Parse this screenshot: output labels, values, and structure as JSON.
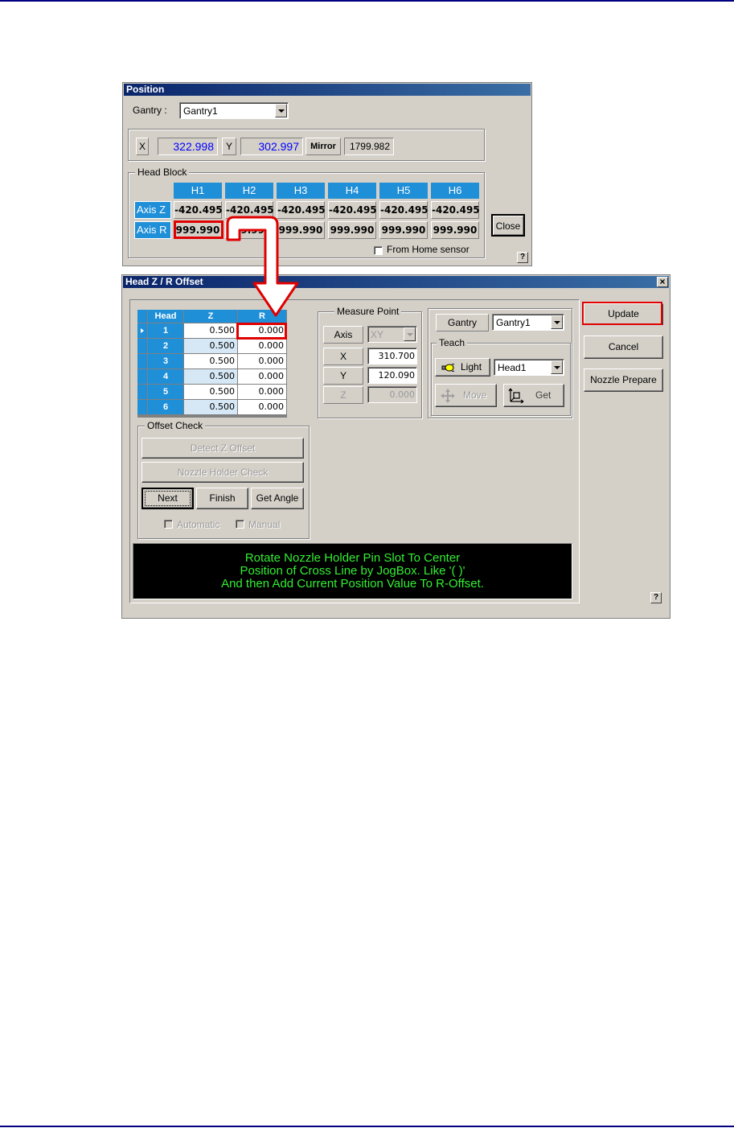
{
  "position_dialog": {
    "title": "Position",
    "gantry_label": "Gantry :",
    "gantry_value": "Gantry1",
    "x_label": "X",
    "x_value": "322.998",
    "y_label": "Y",
    "y_value": "302.997",
    "mirror_label": "Mirror",
    "mirror_value": "1799.982",
    "head_block_label": "Head Block",
    "heads": [
      "H1",
      "H2",
      "H3",
      "H4",
      "H5",
      "H6"
    ],
    "axis_z_label": "Axis Z",
    "axis_z_values": [
      "-420.495",
      "-420.495",
      "-420.495",
      "-420.495",
      "-420.495",
      "-420.495"
    ],
    "axis_r_label": "Axis R",
    "axis_r_values": [
      "999.990",
      "999.990",
      "999.990",
      "999.990",
      "999.990",
      "999.990"
    ],
    "close_label": "Close",
    "from_home_label": "From Home sensor",
    "help_label": "?"
  },
  "offset_dialog": {
    "title": "Head Z / R Offset",
    "close_x": "×",
    "grid": {
      "columns": [
        "Head",
        "Z",
        "R"
      ],
      "rows": [
        {
          "head": "1",
          "z": "0.500",
          "r": "0.000"
        },
        {
          "head": "2",
          "z": "0.500",
          "r": "0.000"
        },
        {
          "head": "3",
          "z": "0.500",
          "r": "0.000"
        },
        {
          "head": "4",
          "z": "0.500",
          "r": "0.000"
        },
        {
          "head": "5",
          "z": "0.500",
          "r": "0.000"
        },
        {
          "head": "6",
          "z": "0.500",
          "r": "0.000"
        }
      ]
    },
    "measure_point": {
      "label": "Measure Point",
      "axis_label": "Axis",
      "axis_value": "XY",
      "x_label": "X",
      "x_value": "310.700",
      "y_label": "Y",
      "y_value": "120.090",
      "z_label": "Z",
      "z_value": "0.000"
    },
    "gantry_label": "Gantry",
    "gantry_value": "Gantry1",
    "teach": {
      "label": "Teach",
      "light_label": "Light",
      "head_value": "Head1",
      "move_label": "Move",
      "get_label": "Get"
    },
    "update_label": "Update",
    "cancel_label": "Cancel",
    "nozzle_prepare_label": "Nozzle Prepare",
    "offset_check": {
      "label": "Offset Check",
      "detect_z_label": "Detect Z Offset",
      "nozzle_holder_label": "Nozzle Holder Check",
      "next_label": "Next",
      "finish_label": "Finish",
      "get_angle_label": "Get Angle",
      "automatic_label": "Automatic",
      "manual_label": "Manual"
    },
    "message_lines": [
      "Rotate Nozzle Holder Pin Slot To Center",
      "Position of Cross Line by JogBox.  Like '( )'",
      "And then Add Current Position Value To R-Offset."
    ],
    "help_label": "?"
  },
  "colors": {
    "header_blue": "#1f8fd8",
    "highlight_red": "#e00000",
    "value_blue": "#0000ff",
    "message_green": "#33ee33"
  }
}
